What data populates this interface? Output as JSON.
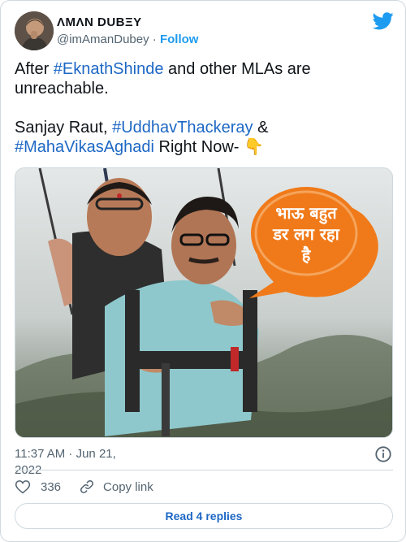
{
  "author": {
    "display_name": "ɅMɅN DUBΞY",
    "handle": "@imAmanDubey",
    "separator": "·",
    "follow_label": "Follow",
    "avatar_icon": "avatar-photo",
    "platform_icon": "twitter-bird-icon"
  },
  "tweet": {
    "line1_prefix": "After ",
    "hashtag1": "#EknathShinde",
    "line1_suffix": " and other MLAs are unreachable.",
    "line2_prefix": "Sanjay Raut, ",
    "hashtag2": "#UddhavThackeray",
    "line2_suffix": "  &",
    "hashtag3": "#MahaVikasAghadi",
    "line3_suffix": " Right Now- ",
    "emoji": "👇"
  },
  "media": {
    "speech_bubble_line1": "भाऊ बहुत",
    "speech_bubble_line2": "डर लग रहा",
    "speech_bubble_line3": "है"
  },
  "footer": {
    "timestamp": "11:37 AM · Jun 21, 2022",
    "like_count": "336",
    "copy_link_label": "Copy link",
    "read_replies_label": "Read 4 replies"
  },
  "colors": {
    "link_blue": "#1d67c4",
    "twitter_blue": "#1d9bf0",
    "secondary_text": "#536471",
    "bubble_orange": "#f07a1a"
  }
}
